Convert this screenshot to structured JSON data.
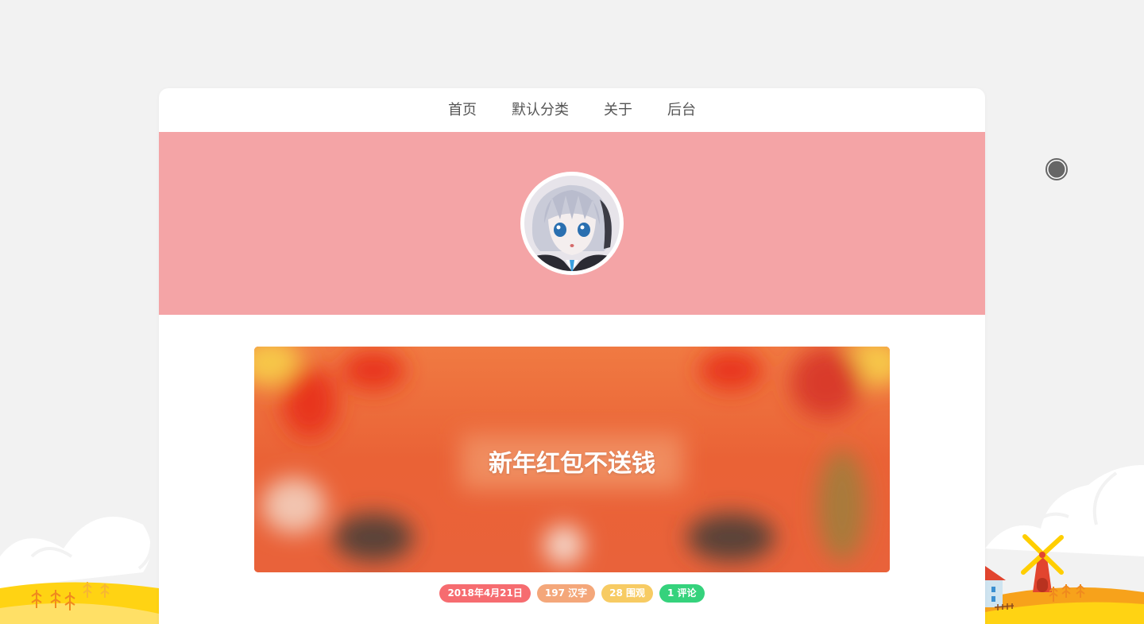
{
  "nav": {
    "items": [
      {
        "label": "首页"
      },
      {
        "label": "默认分类"
      },
      {
        "label": "关于"
      },
      {
        "label": "后台"
      }
    ]
  },
  "post": {
    "title": "新年红包不送钱",
    "meta": [
      {
        "text": "2018年4月21日",
        "color": "#f66c70"
      },
      {
        "text": "197 汉字",
        "color": "#f4a77a"
      },
      {
        "text": "28 围观",
        "color": "#f7cb63"
      },
      {
        "text": "1 评论",
        "color": "#35d27c"
      }
    ]
  },
  "colors": {
    "hero": "#f4a4a6",
    "background": "#f2f2f2",
    "card": "#ffffff"
  },
  "icons": {
    "music": "music-disc-icon",
    "avatar": "anime-avatar-image"
  }
}
